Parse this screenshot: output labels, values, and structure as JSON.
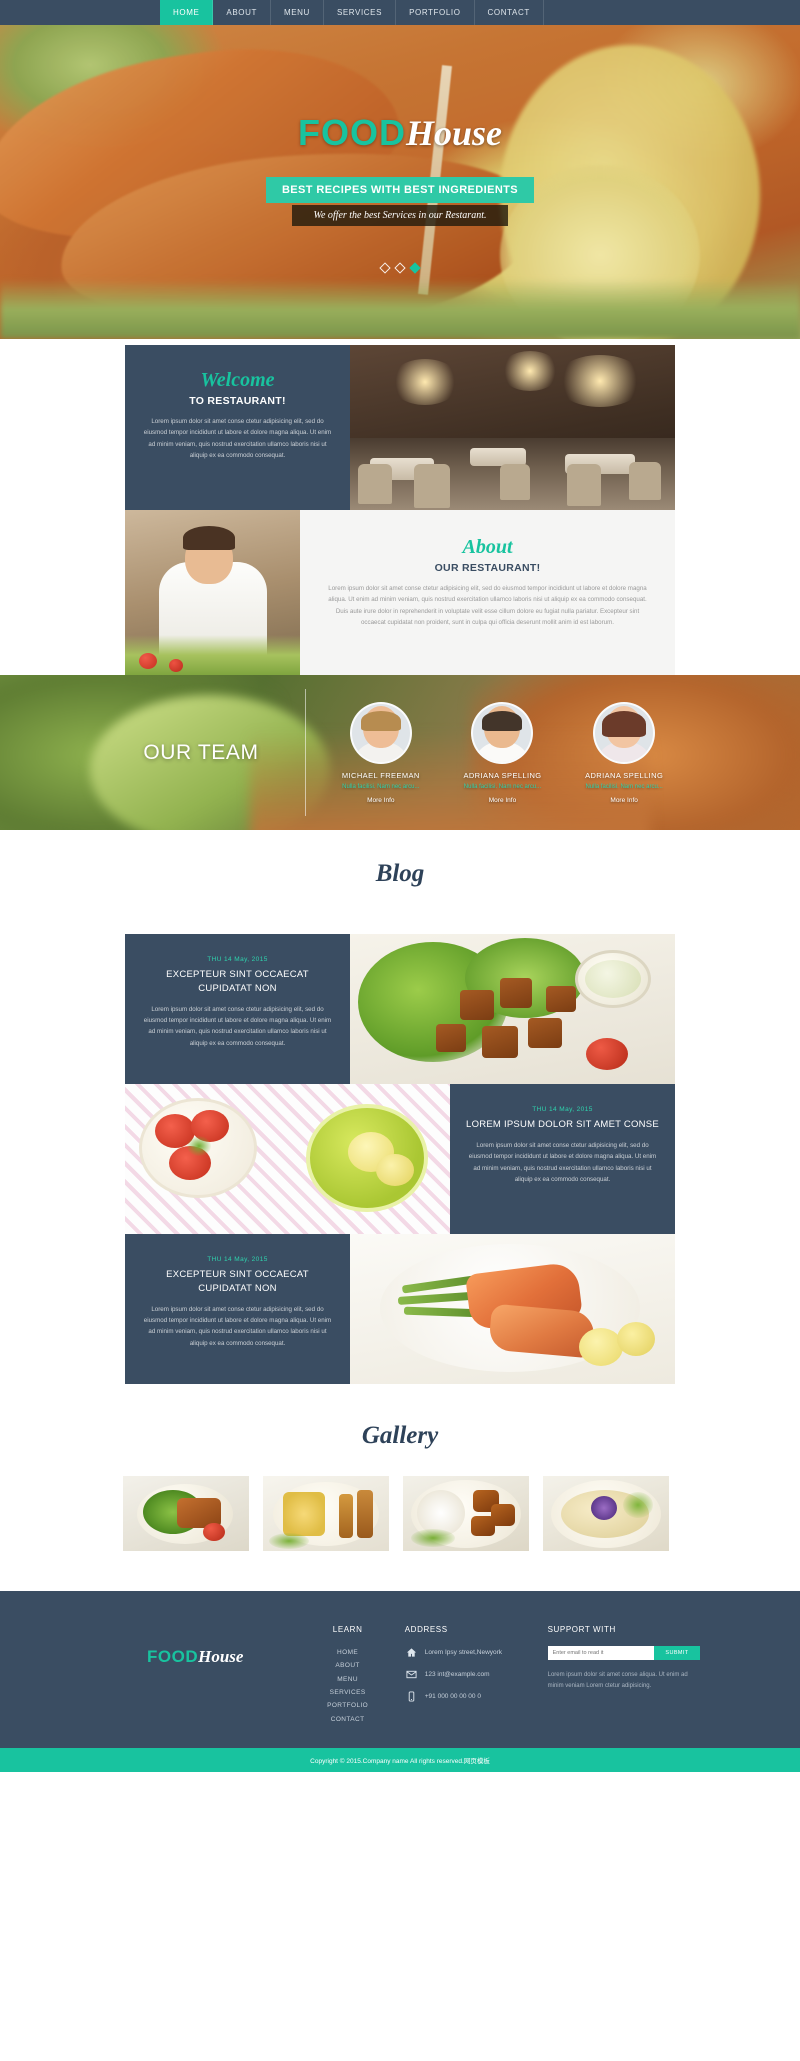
{
  "nav": {
    "items": [
      {
        "label": "HOME",
        "active": true
      },
      {
        "label": "ABOUT",
        "active": false
      },
      {
        "label": "MENU",
        "active": false
      },
      {
        "label": "SERVICES",
        "active": false
      },
      {
        "label": "PORTFOLIO",
        "active": false
      },
      {
        "label": "CONTACT",
        "active": false
      }
    ]
  },
  "hero": {
    "logo_primary": "FOOD",
    "logo_secondary": "House",
    "tagline": "BEST RECIPES WITH BEST INGREDIENTS",
    "subtitle": "We offer the best Services in our Restarant.",
    "slide_count": 3,
    "active_slide": 3
  },
  "welcome": {
    "script_title": "Welcome",
    "subtitle": "TO RESTAURANT!",
    "body": "Lorem ipsum dolor sit amet conse ctetur adipisicing elit, sed do eiusmod tempor incididunt ut labore et dolore magna aliqua. Ut enim ad minim veniam, quis nostrud exercitation ullamco laboris nisi ut aliquip ex ea commodo consequat."
  },
  "about": {
    "script_title": "About",
    "subtitle": "OUR RESTAURANT!",
    "body": "Lorem ipsum dolor sit amet conse ctetur adipisicing elit, sed do eiusmod tempor incididunt ut labore et dolore magna aliqua. Ut enim ad minim veniam, quis nostrud exercitation ullamco laboris nisi ut aliquip ex ea commodo consequat. Duis aute irure dolor in reprehenderit in voluptate velit esse cillum dolore eu fugiat nulla pariatur. Excepteur sint occaecat cupidatat non proident, sunt in culpa qui officia deserunt mollit anim id est laborum."
  },
  "team": {
    "title": "OUR TEAM",
    "members": [
      {
        "name": "MICHAEL FREEMAN",
        "desc": "Nulla facilisi. Nam nec arcu...",
        "link": "More Info"
      },
      {
        "name": "ADRIANA SPELLING",
        "desc": "Nulla facilisi. Nam nec arcu...",
        "link": "More Info"
      },
      {
        "name": "ADRIANA SPELLING",
        "desc": "Nulla facilisi. Nam nec arcu...",
        "link": "More Info"
      }
    ]
  },
  "blog": {
    "title": "Blog",
    "posts": [
      {
        "date": "THU 14 May, 2015",
        "title": "EXCEPTEUR SINT OCCAECAT CUPIDATAT NON",
        "body": "Lorem ipsum dolor sit amet conse ctetur adipisicing elit, sed do eiusmod tempor incididunt ut labore et dolore magna aliqua. Ut enim ad minim veniam, quis nostrud exercitation ullamco laboris nisi ut aliquip ex ea commodo consequat."
      },
      {
        "date": "THU 14 May, 2015",
        "title": "LOREM IPSUM DOLOR SIT AMET CONSE",
        "body": "Lorem ipsum dolor sit amet conse ctetur adipisicing elit, sed do eiusmod tempor incididunt ut labore et dolore magna aliqua. Ut enim ad minim veniam, quis nostrud exercitation ullamco laboris nisi ut aliquip ex ea commodo consequat."
      },
      {
        "date": "THU 14 May, 2015",
        "title": "EXCEPTEUR SINT OCCAECAT CUPIDATAT NON",
        "body": "Lorem ipsum dolor sit amet conse ctetur adipisicing elit, sed do eiusmod tempor incididunt ut labore et dolore magna aliqua. Ut enim ad minim veniam, quis nostrud exercitation ullamco laboris nisi ut aliquip ex ea commodo consequat."
      }
    ]
  },
  "gallery": {
    "title": "Gallery",
    "items": [
      {
        "alt": "grilled-meat-salad-bowl"
      },
      {
        "alt": "grilled-skewers-plate"
      },
      {
        "alt": "fried-meat-balls-plate"
      },
      {
        "alt": "rice-dish-with-flower"
      }
    ]
  },
  "footer": {
    "logo_primary": "FOOD",
    "logo_secondary": "House",
    "learn": {
      "heading": "LEARN",
      "links": [
        "HOME",
        "ABOUT",
        "MENU",
        "SERVICES",
        "PORTFOLIO",
        "CONTACT"
      ]
    },
    "address": {
      "heading": "ADDRESS",
      "street": "Lorem Ipsy street,Newyork",
      "email": "123 int@example.com",
      "phone": "+91 000 00 00 00 0",
      "icons": [
        "home-icon",
        "envelope-icon",
        "phone-icon"
      ]
    },
    "support": {
      "heading": "SUPPORT WITH",
      "input_placeholder": "Enter email to read it",
      "submit_label": "SUBMIT",
      "note": "Lorem ipsum dolor sit amet conse aliqua. Ut enim ad minim veniam Lorem ctetur adipisicing."
    },
    "copyright": "Copyright © 2015.Company name All rights reserved.网页模板"
  },
  "colors": {
    "accent_teal": "#18c39f",
    "dark_navy": "#3a4d62",
    "light_gray": "#f5f5f4"
  }
}
